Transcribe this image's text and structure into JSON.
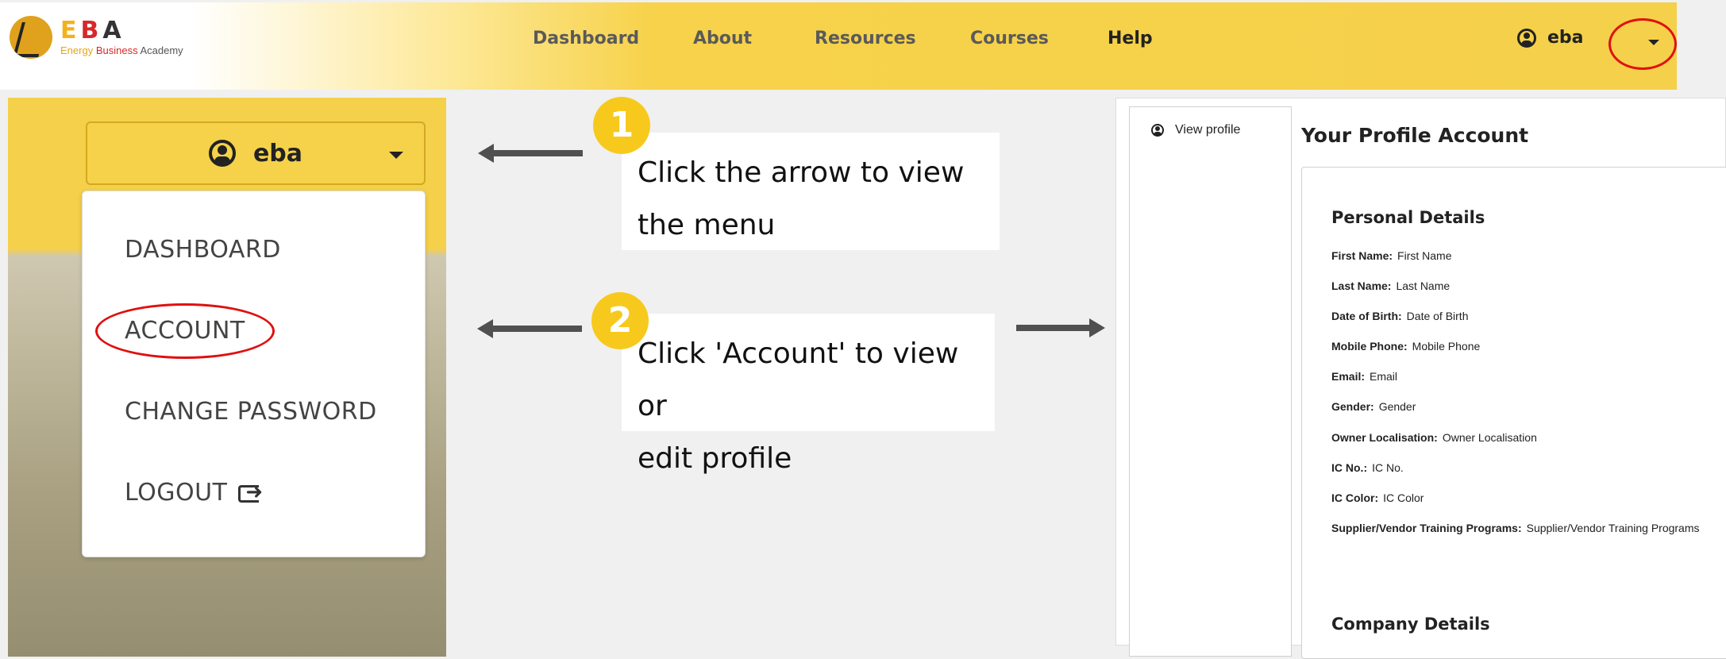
{
  "brand": {
    "letters": [
      "E",
      "B",
      "A"
    ],
    "tagline_1": "Energy",
    "tagline_2": "Business",
    "tagline_3": "Academy"
  },
  "nav": {
    "items": [
      "Dashboard",
      "About",
      "Resources",
      "Courses",
      "Help"
    ],
    "username": "eba"
  },
  "dropdown": {
    "username": "eba",
    "items": [
      "DASHBOARD",
      "ACCOUNT",
      "CHANGE PASSWORD",
      "LOGOUT"
    ]
  },
  "callouts": [
    {
      "step": "1",
      "line1": "Click the arrow to view",
      "line2": "the menu"
    },
    {
      "step": "2",
      "line1": "Click 'Account' to view or",
      "line2": "edit profile"
    }
  ],
  "profile": {
    "sidebar_link": "View profile",
    "title": "Your Profile Account",
    "personal_heading": "Personal Details",
    "fields": [
      {
        "label": "First Name:",
        "value": "First Name"
      },
      {
        "label": "Last Name:",
        "value": "Last Name"
      },
      {
        "label": "Date of Birth:",
        "value": "Date of Birth"
      },
      {
        "label": "Mobile Phone:",
        "value": "Mobile Phone"
      },
      {
        "label": "Email:",
        "value": "Email"
      },
      {
        "label": "Gender:",
        "value": "Gender"
      },
      {
        "label": "Owner Localisation:",
        "value": "Owner Localisation"
      },
      {
        "label": "IC No.:",
        "value": "IC No."
      },
      {
        "label": "IC Color:",
        "value": "IC Color"
      },
      {
        "label": "Supplier/Vendor Training Programs:",
        "value": "Supplier/Vendor Training Programs"
      }
    ],
    "company_heading": "Company Details"
  },
  "colors": {
    "accent_yellow": "#f5d04a",
    "highlight_red": "#e01010",
    "arrow_gray": "#505050"
  }
}
